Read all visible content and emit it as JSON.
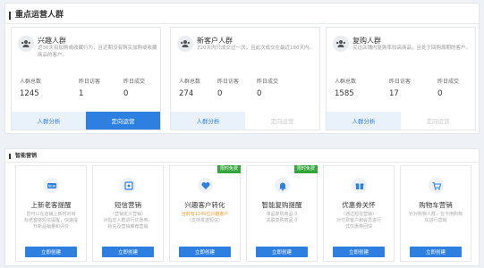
{
  "section1": {
    "title": "重点运营人群",
    "cards": [
      {
        "title": "兴趣人群",
        "desc": "近30天有加购或收藏行为，且近期没有购买加购或收藏商品的客户。",
        "stats": [
          {
            "label": "人群总数",
            "value": "1245"
          },
          {
            "label": "昨日访客",
            "value": "1"
          },
          {
            "label": "昨日成交",
            "value": "0"
          }
        ],
        "btn1": "人群分析",
        "btn2": "定向运营",
        "btn2_style": "blue"
      },
      {
        "title": "新客户人群",
        "desc": "720天内只成交过一次，且此次成交在最近180天内。",
        "stats": [
          {
            "label": "人群总数",
            "value": "274"
          },
          {
            "label": "昨日访客",
            "value": "0"
          },
          {
            "label": "昨日成交",
            "value": "0"
          }
        ],
        "btn1": "人群分析",
        "btn2": "定向运营",
        "btn2_style": "disabled"
      },
      {
        "title": "复购人群",
        "desc": "买过店铺内复购率较高商品，且处于回购周期的客户。",
        "stats": [
          {
            "label": "人群总数",
            "value": "1585"
          },
          {
            "label": "昨日访客",
            "value": "17"
          },
          {
            "label": "昨日成交",
            "value": "0"
          }
        ],
        "btn1": "人群分析",
        "btn2": "定向运营",
        "btn2_style": "disabled"
      }
    ]
  },
  "section2": {
    "title": "智能营销",
    "tiles": [
      {
        "title": "上新老客提醒",
        "desc_lines": [
          "您可以在店铺上新时对目",
          "标老客做短信提醒，快速提",
          "升新品销量和评价"
        ],
        "badge": "",
        "btn": "立即创建",
        "icon": "new-icon"
      },
      {
        "title": "短信营销",
        "desc_lines": [
          "（营销定义营销）",
          "对指定人群进行优惠券，",
          "抢先及营销推荐营销"
        ],
        "badge": "",
        "btn": "立即创建",
        "icon": "coupon-icon"
      },
      {
        "title": "兴趣客户转化",
        "desc_lines": [
          "当前有1245位兴趣客户",
          "（支持发送短信）"
        ],
        "badge": "限时免费",
        "btn": "立即创建",
        "icon": "heart-icon",
        "highlight_first": true
      },
      {
        "title": "智能复购提醒",
        "desc_lines": [
          "单品复购商品 0",
          "关联复购商品 0"
        ],
        "badge": "限时免费",
        "btn": "立即创建",
        "icon": "bell-icon"
      },
      {
        "title": "优惠券关怀",
        "desc_lines": [
          "（通过短信营销）",
          "对付费客户和会员进行",
          "式优惠券回馈"
        ],
        "badge": "",
        "btn": "立即创建",
        "icon": "gift-icon"
      },
      {
        "title": "购物车营销",
        "desc_lines": [
          "针对购物人群，在卡用购物",
          "车进行营销"
        ],
        "badge": "",
        "btn": "立即创建",
        "icon": "cart-icon"
      }
    ]
  },
  "colors": {
    "accent": "#2e80e0",
    "badge": "#33a53a",
    "highlight": "#f29b2f"
  }
}
